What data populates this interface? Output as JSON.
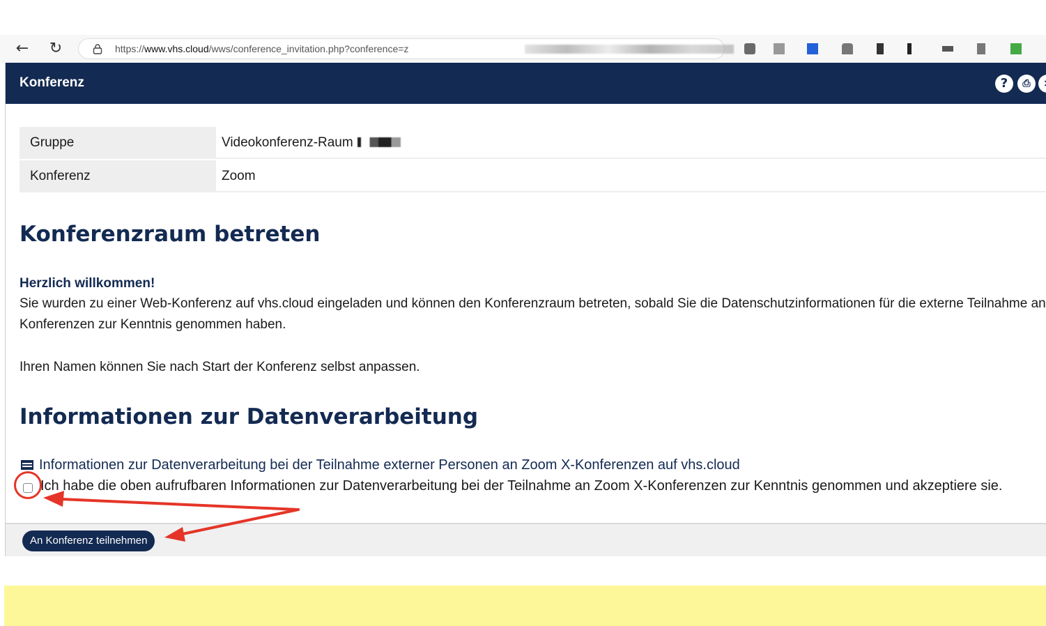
{
  "browser": {
    "url_prefix": "https://",
    "url_domain": "www.vhs.cloud",
    "url_path": "/wws/conference_invitation.php?conference=z"
  },
  "header": {
    "title": "Konferenz"
  },
  "info": {
    "rows": [
      {
        "label": "Gruppe",
        "value": "Videokonferenz-Raum"
      },
      {
        "label": "Konferenz",
        "value": "Zoom"
      }
    ]
  },
  "enter": {
    "heading": "Konferenzraum betreten",
    "welcome": "Herzlich willkommen!",
    "paragraph1": "Sie wurden zu einer Web-Konferenz auf vhs.cloud eingeladen und können den Konferenzraum betreten, sobald Sie die Datenschutzinformationen für die externe Teilnahme an Konferenzen zur Kenntnis genommen haben.",
    "paragraph2": "Ihren Namen können Sie nach Start der Konferenz selbst anpassen."
  },
  "data_info": {
    "heading": "Informationen zur Datenverarbeitung",
    "link": "Informationen zur Datenverarbeitung bei der Teilnahme externer Personen an Zoom X-Konferenzen auf vhs.cloud",
    "consent": "Ich habe die oben aufrufbaren Informationen zur Datenverarbeitung bei der Teilnahme an Zoom X-Konferenzen zur Kenntnis genommen und akzeptiere sie.",
    "consent_checked": false
  },
  "footer": {
    "join_label": "An Konferenz teilnehmen"
  },
  "colors": {
    "header_bg": "#132a52",
    "annotation": "#e53528",
    "band": "#fdf79a"
  }
}
